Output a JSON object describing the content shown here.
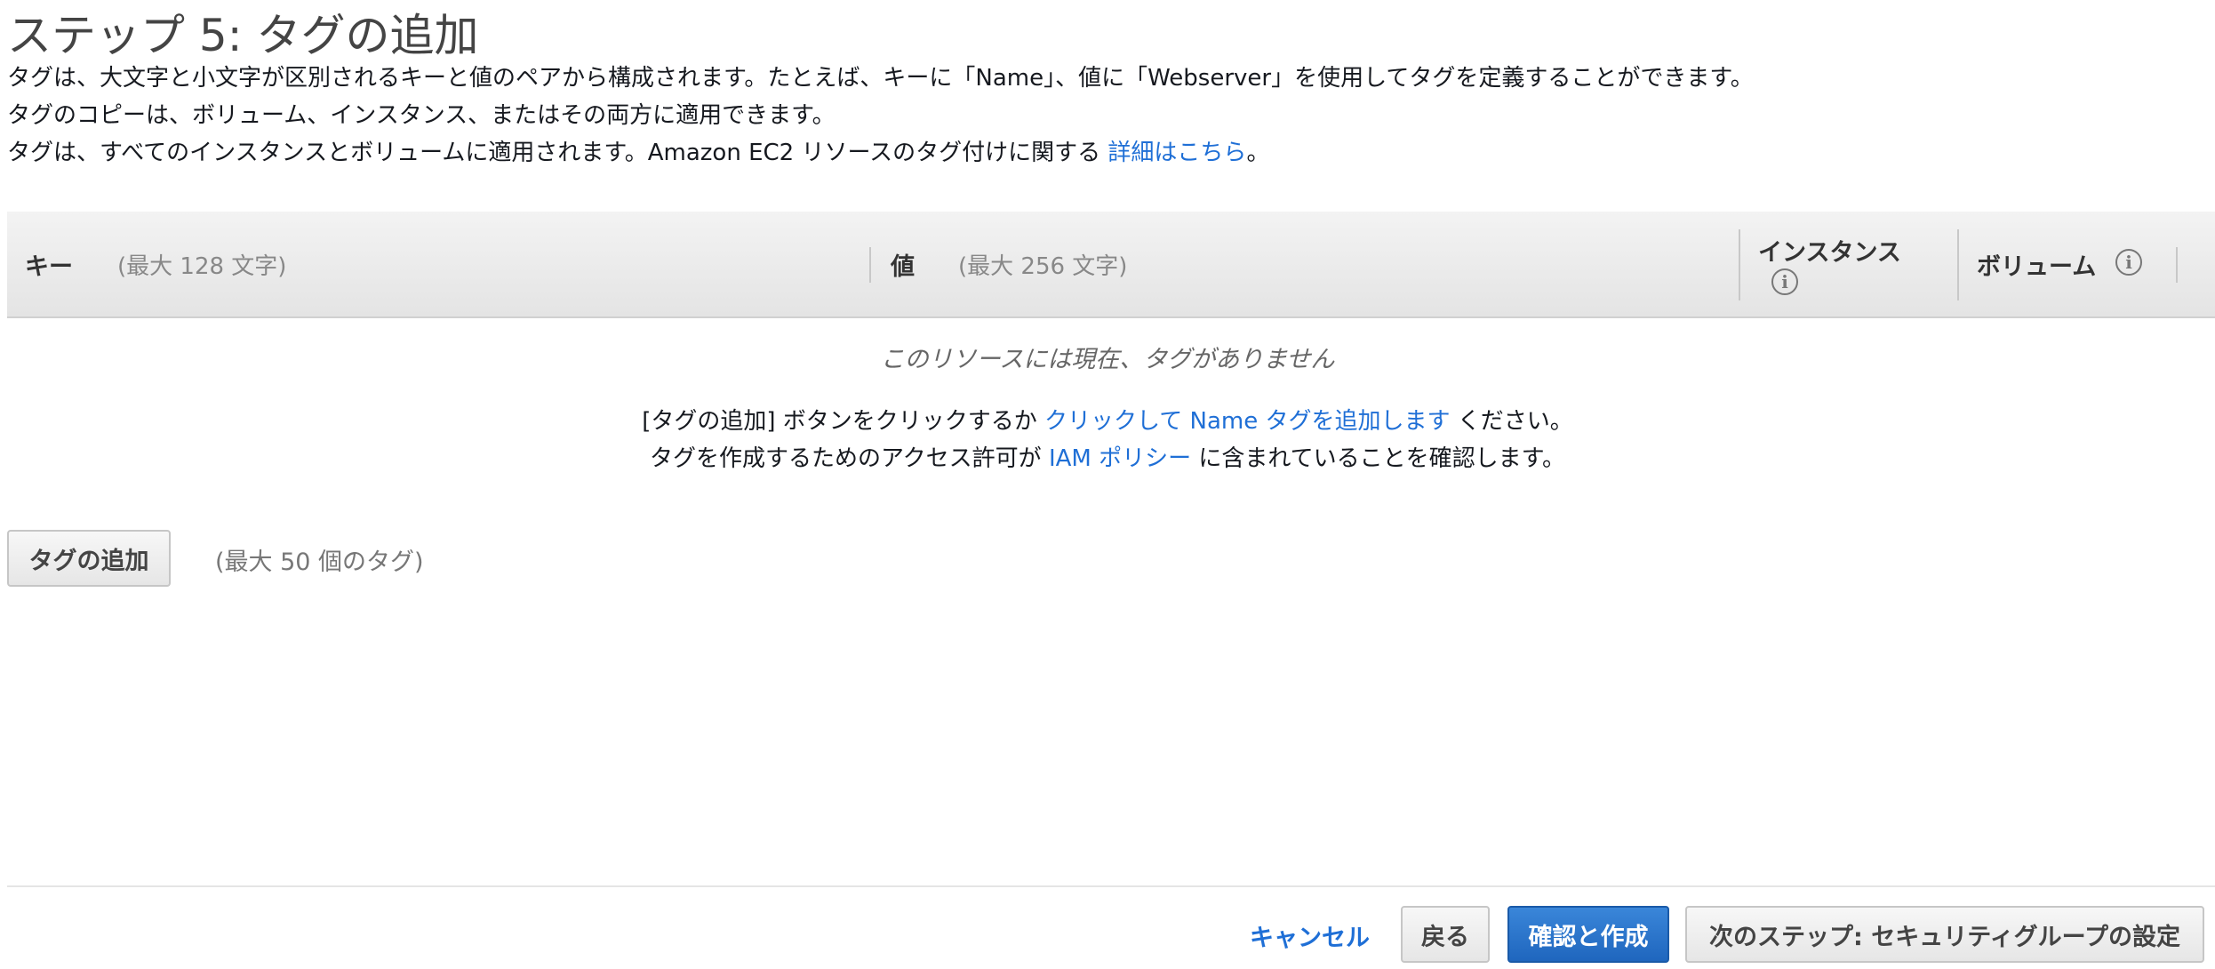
{
  "page": {
    "title": "ステップ 5: タグの追加",
    "description": {
      "line1": "タグは、大文字と小文字が区別されるキーと値のペアから構成されます。たとえば、キーに「Name」、値に「Webserver」を使用してタグを定義することができます。",
      "line2": "タグのコピーは、ボリューム、インスタンス、またはその両方に適用できます。",
      "line3_prefix": "タグは、すべてのインスタンスとボリュームに適用されます。Amazon EC2 リソースのタグ付けに関する",
      "line3_link": "詳細はこちら",
      "line3_suffix": "。"
    }
  },
  "table": {
    "headers": {
      "key_label": "キー",
      "key_hint": "(最大 128 文字)",
      "value_label": "値",
      "value_hint": "(最大 256 文字)",
      "instance_label": "インスタンス",
      "volume_label": "ボリューム"
    },
    "info_icon": {
      "icon": "info-icon",
      "glyph": "i"
    },
    "empty_state": {
      "title": "このリソースには現在、タグがありません",
      "line1_prefix": "[タグの追加] ボタンをクリックするか",
      "line1_link": "クリックして Name タグを追加します",
      "line1_suffix": "ください。",
      "line2_prefix": "タグを作成するためのアクセス許可が",
      "line2_link": "IAM ポリシー",
      "line2_suffix": "に含まれていることを確認します。"
    }
  },
  "add_tag": {
    "button_label": "タグの追加",
    "hint": "(最大 50 個のタグ)"
  },
  "footer": {
    "cancel_label": "キャンセル",
    "back_label": "戻る",
    "review_label": "確認と作成",
    "next_label": "次のステップ: セキュリティグループの設定"
  },
  "colors": {
    "link": "#1f6fd6",
    "primary_button": "#2a74cc",
    "header_bg": "#ececec"
  }
}
